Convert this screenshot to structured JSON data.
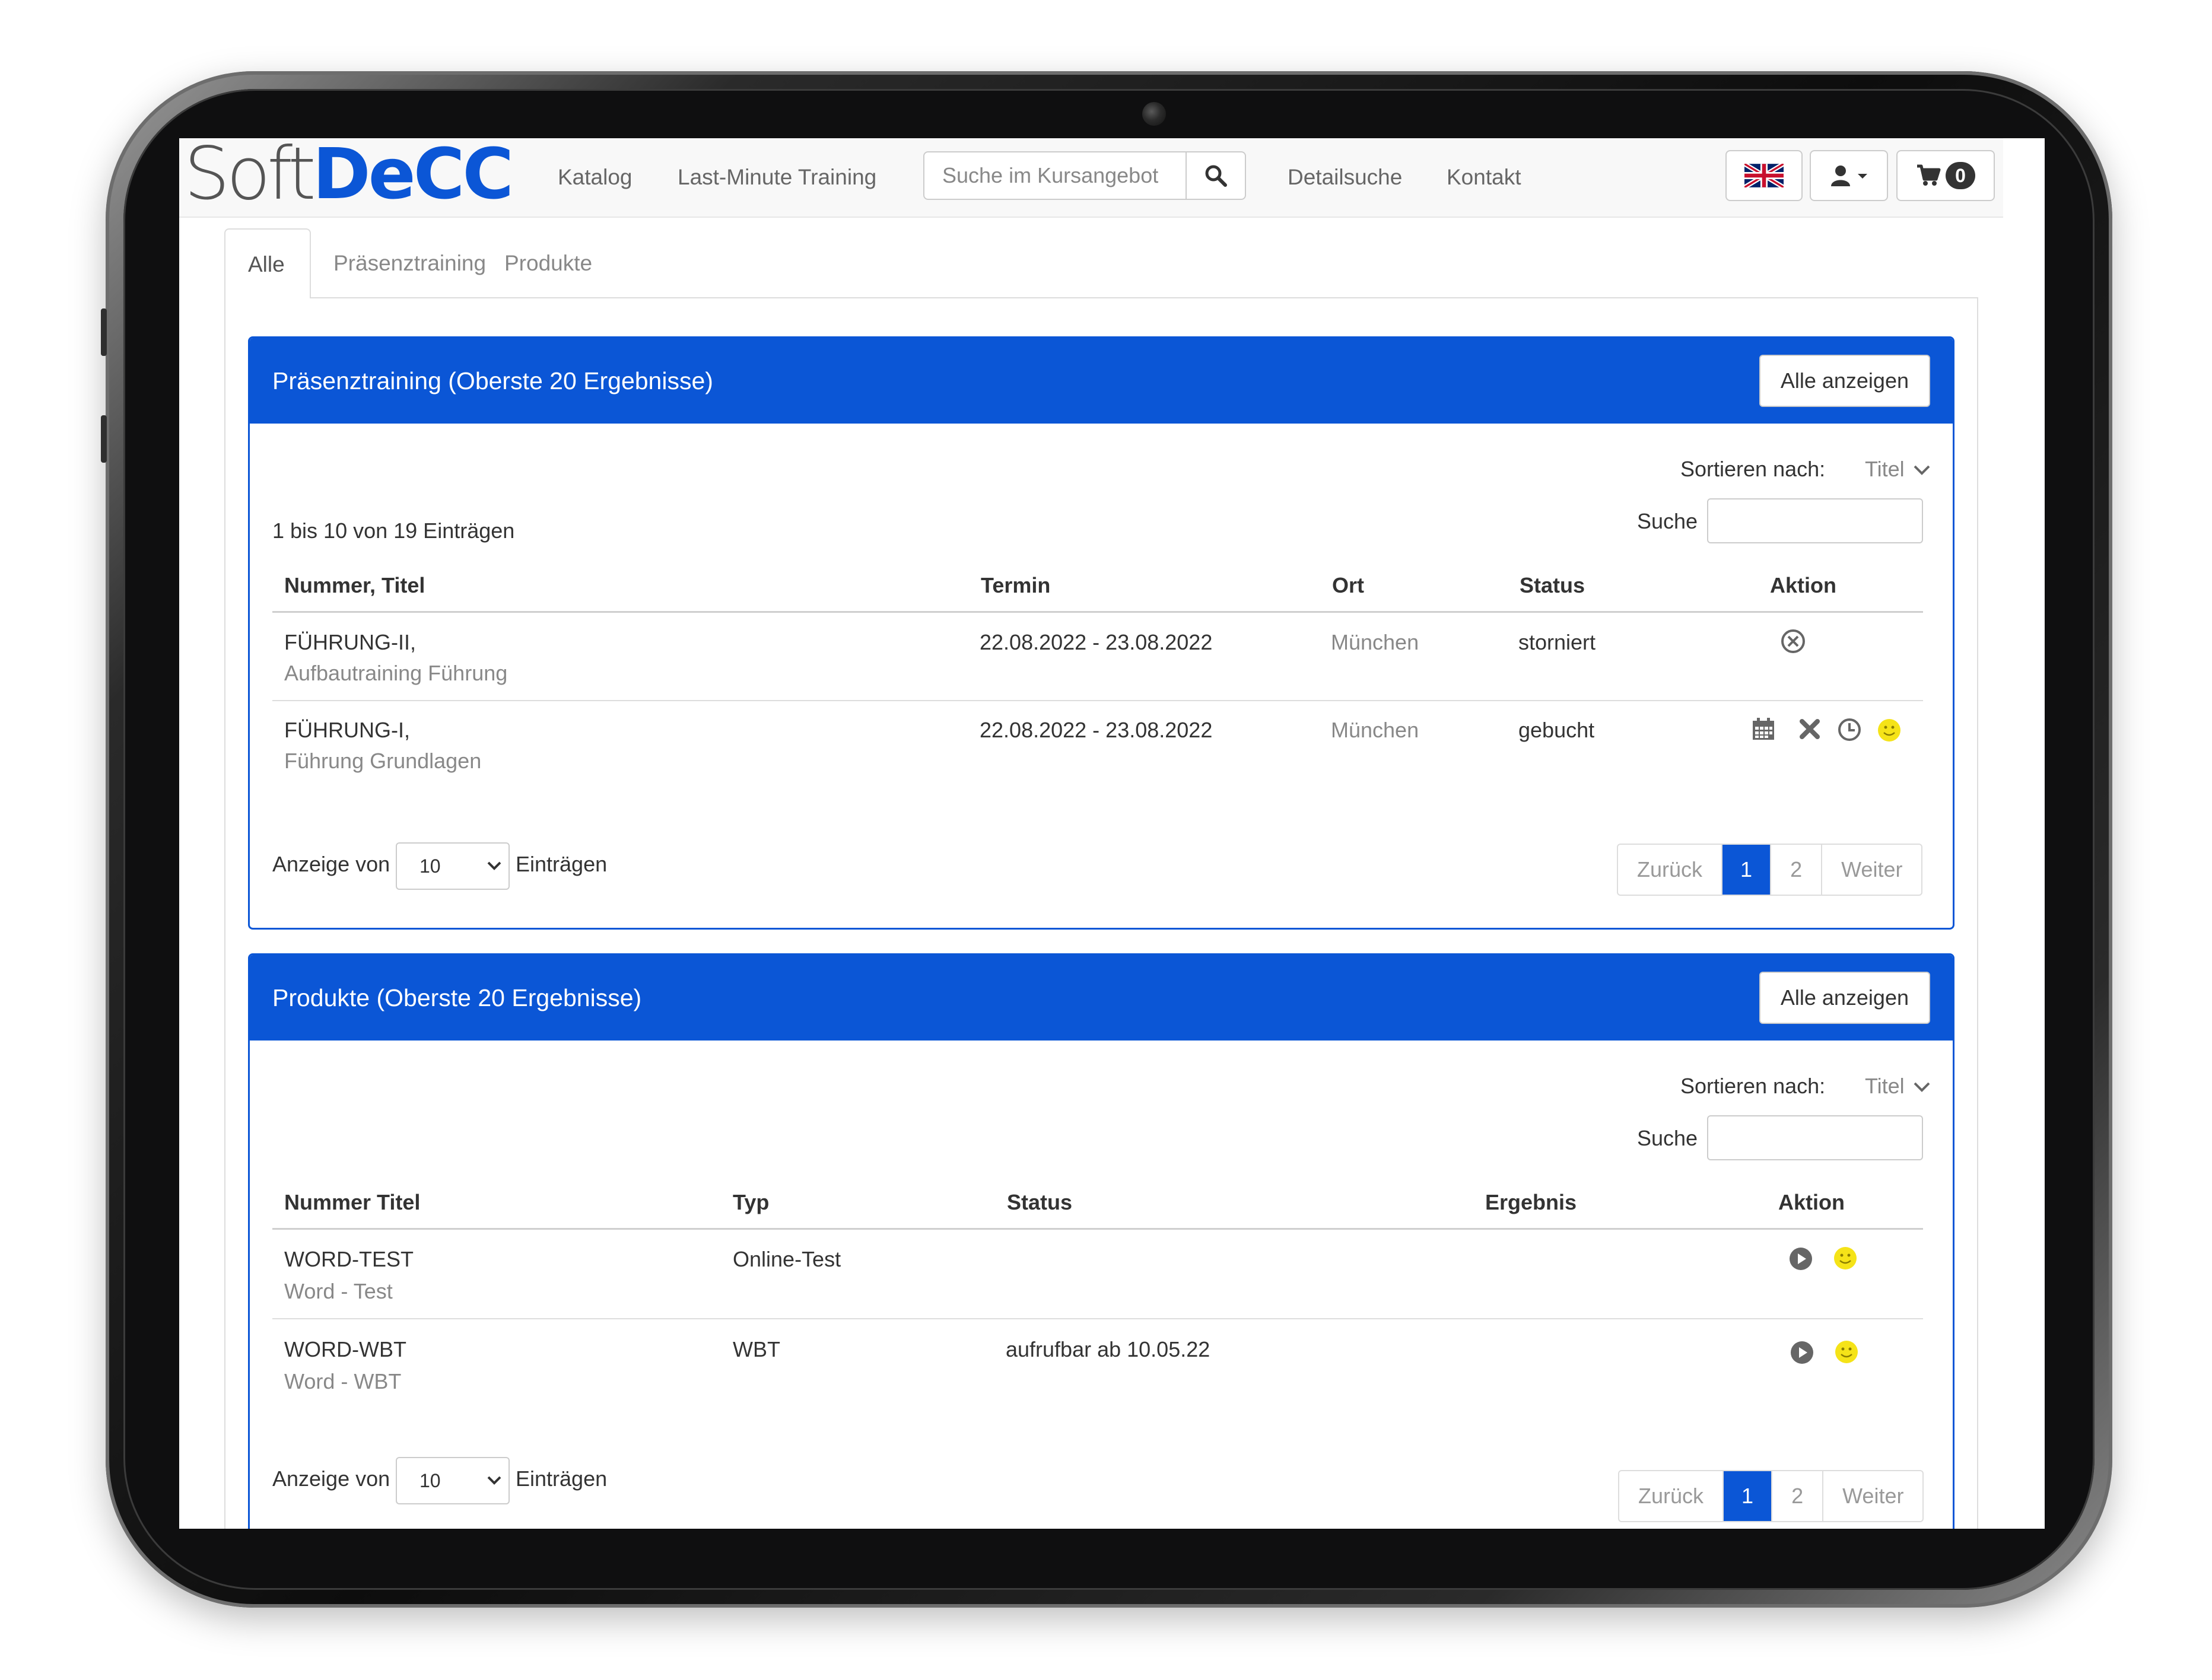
{
  "brand": {
    "soft": "Soft",
    "decc": "DeCC"
  },
  "navbar": {
    "links": [
      "Katalog",
      "Last-Minute Training"
    ],
    "search_placeholder": "Suche im Kursangebot",
    "links_right": [
      "Detailsuche",
      "Kontakt"
    ],
    "cart_count": "0"
  },
  "tabs": [
    "Alle",
    "Präsenztraining",
    "Produkte"
  ],
  "panel1": {
    "title": "Präsenztraining (Oberste 20 Ergebnisse)",
    "show_all": "Alle anzeigen",
    "sort_label": "Sortieren nach:",
    "sort_value": "Titel",
    "search_label": "Suche",
    "info": "1 bis 10 von 19 Einträgen",
    "columns": [
      "Nummer, Titel",
      "Termin",
      "Ort",
      "Status",
      "Aktion"
    ],
    "rows": [
      {
        "number": "FÜHRUNG-II,",
        "title": "Aufbautraining Führung",
        "date": "22.08.2022 - 23.08.2022",
        "place": "München",
        "status": "storniert"
      },
      {
        "number": "FÜHRUNG-I,",
        "title": "Führung Grundlagen",
        "date": "22.08.2022 - 23.08.2022",
        "place": "München",
        "status": "gebucht"
      }
    ],
    "length_prefix": "Anzeige von",
    "length_value": "10",
    "length_suffix": "Einträgen",
    "pager": {
      "prev": "Zurück",
      "pages": [
        "1",
        "2"
      ],
      "next": "Weiter"
    }
  },
  "panel2": {
    "title": "Produkte (Oberste 20 Ergebnisse)",
    "show_all": "Alle anzeigen",
    "sort_label": "Sortieren nach:",
    "sort_value": "Titel",
    "search_label": "Suche",
    "columns": [
      "Nummer Titel",
      "Typ",
      "Status",
      "Ergebnis",
      "Aktion"
    ],
    "rows": [
      {
        "number": "WORD-TEST",
        "title": "Word - Test",
        "type": "Online-Test",
        "status": ""
      },
      {
        "number": "WORD-WBT",
        "title": "Word - WBT",
        "type": "WBT",
        "status": "aufrufbar ab 10.05.22"
      }
    ],
    "length_prefix": "Anzeige von",
    "length_value": "10",
    "length_suffix": "Einträgen",
    "pager": {
      "prev": "Zurück",
      "pages": [
        "1",
        "2"
      ],
      "next": "Weiter"
    }
  },
  "colors": {
    "brand_blue": "#0b56d6",
    "smiley_yellow": "#f5e318"
  }
}
